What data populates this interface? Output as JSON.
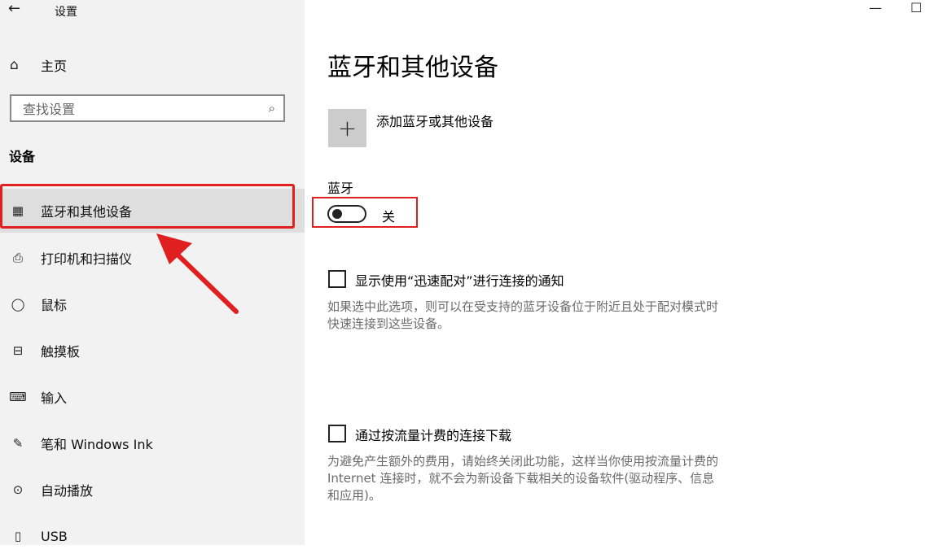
{
  "window": {
    "title": "设置",
    "back_icon": "←",
    "minimize_icon": "—",
    "maximize_icon": "☐"
  },
  "sidebar": {
    "home": {
      "label": "主页",
      "icon": "⌂"
    },
    "search": {
      "placeholder": "查找设置",
      "icon": "⌕"
    },
    "section_heading": "设备",
    "items": [
      {
        "label": "蓝牙和其他设备",
        "icon": "▦",
        "selected": true
      },
      {
        "label": "打印机和扫描仪",
        "icon": "⎙"
      },
      {
        "label": "鼠标",
        "icon": "◯"
      },
      {
        "label": "触摸板",
        "icon": "⊟"
      },
      {
        "label": "输入",
        "icon": "⌨"
      },
      {
        "label": "笔和 Windows Ink",
        "icon": "✎"
      },
      {
        "label": "自动播放",
        "icon": "⊙"
      },
      {
        "label": "USB",
        "icon": "▯"
      }
    ]
  },
  "main": {
    "title": "蓝牙和其他设备",
    "add_device": {
      "icon": "+",
      "label": "添加蓝牙或其他设备"
    },
    "bluetooth": {
      "label": "蓝牙",
      "state_label": "关",
      "on": false
    },
    "swift_pair": {
      "label": "显示使用“迅速配对”进行连接的通知",
      "checked": false,
      "description_line1": "如果选中此选项，则可以在受支持的蓝牙设备位于附近且处于配对模式时",
      "description_line2": "快速连接到这些设备。"
    },
    "metered": {
      "label": "通过按流量计费的连接下载",
      "checked": false,
      "description_line1": "为避免产生额外的费用，请始终关闭此功能，这样当你使用按流量计费的",
      "description_line2": "Internet 连接时，就不会为新设备下载相关的设备软件(驱动程序、信息",
      "description_line3": "和应用)。"
    }
  },
  "colors": {
    "annotation": "#e02020",
    "sidebar_bg": "#f2f2f2",
    "selected_bg": "#dedede"
  }
}
